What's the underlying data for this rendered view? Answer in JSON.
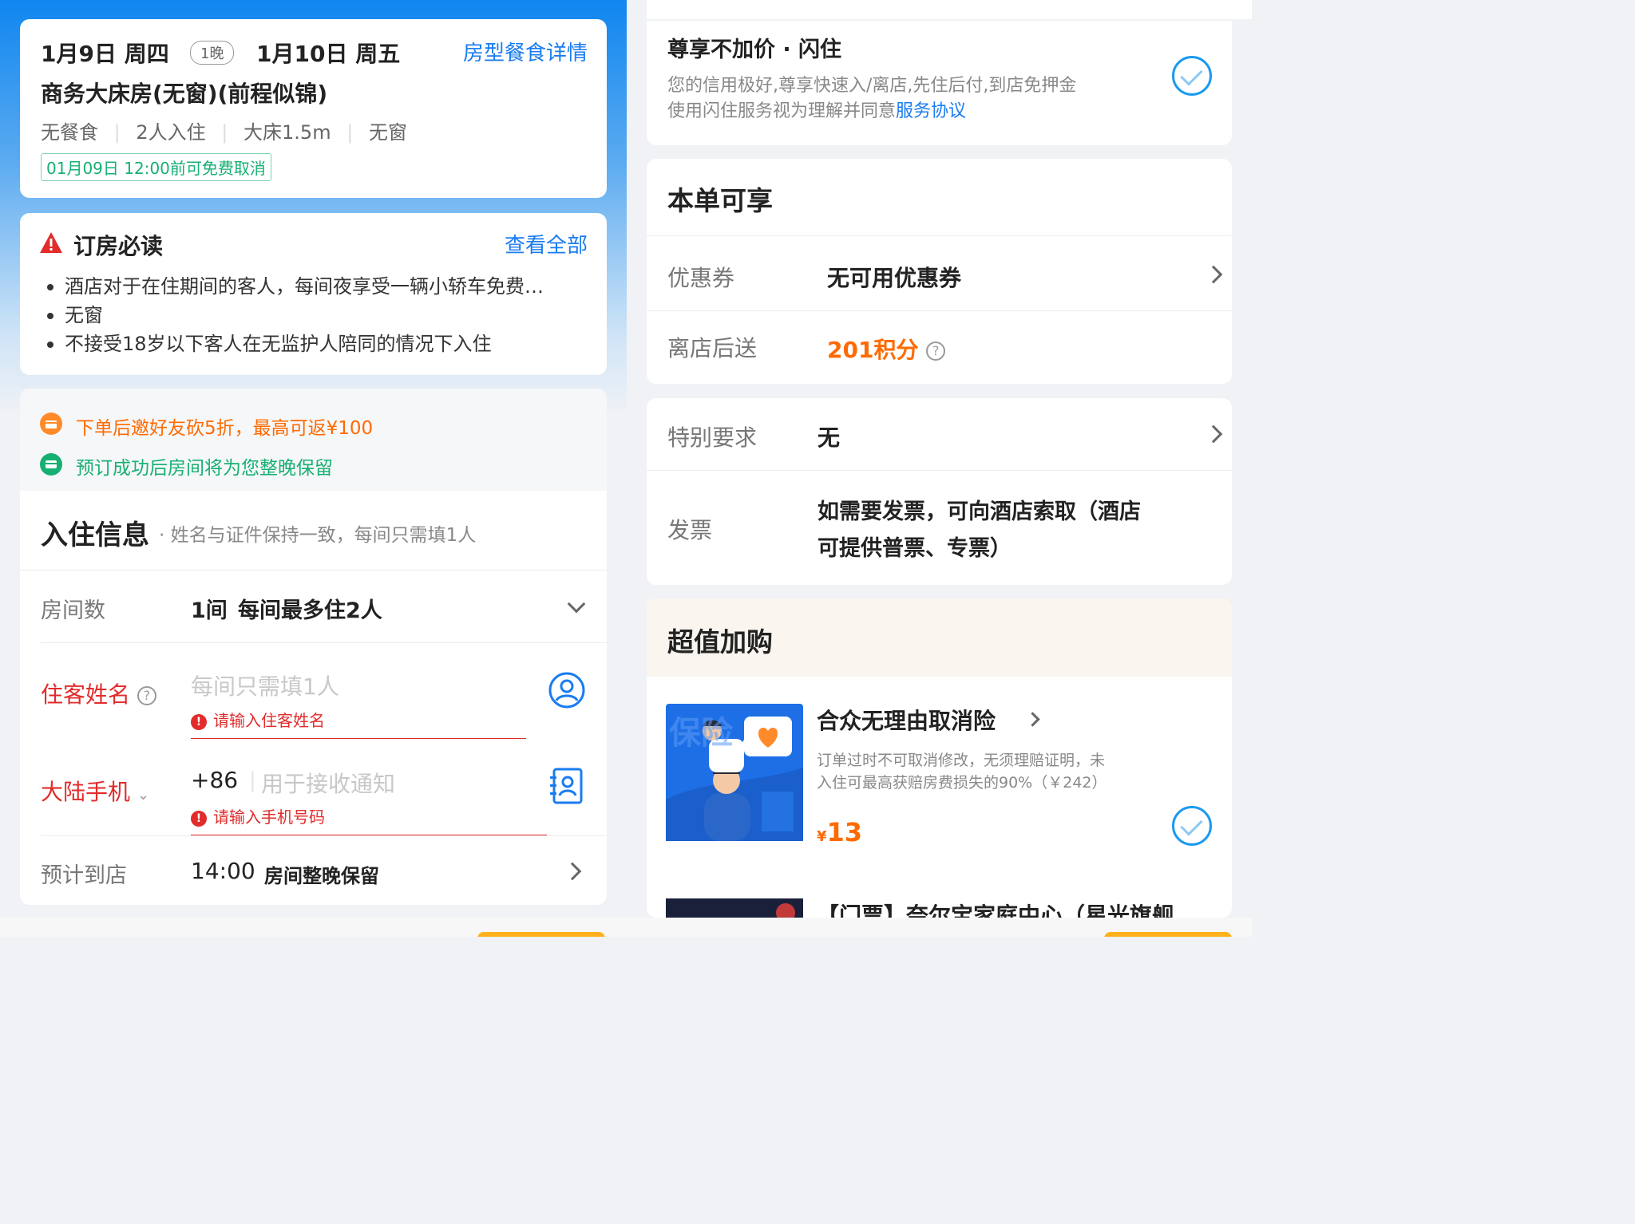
{
  "room_card": {
    "checkin": "1月9日 周四",
    "nights": "1晚",
    "checkout": "1月10日 周五",
    "detail_link": "房型餐食详情",
    "room_name": "商务大床房(无窗)(前程似锦)",
    "attrs": [
      "无餐食",
      "2人入住",
      "大床1.5m",
      "无窗"
    ],
    "cancel_policy": "01月09日 12:00前可免费取消"
  },
  "notice": {
    "title": "订房必读",
    "view_all": "查看全部",
    "items": [
      "酒店对于在住期间的客人，每间夜享受一辆小轿车免费…",
      "无窗",
      "不接受18岁以下客人在无监护人陪同的情况下入住"
    ]
  },
  "promos": {
    "invite": "下单后邀好友砍5折，最高可返¥100",
    "reserve": "预订成功后房间将为您整晚保留"
  },
  "guest_info": {
    "title": "入住信息",
    "subtitle": "· 姓名与证件保持一致，每间只需填1人",
    "rooms_label": "房间数",
    "rooms_value": "1间",
    "rooms_note": "每间最多住2人",
    "name_label": "住客姓名",
    "name_placeholder": "每间只需填1人",
    "name_error": "请输入住客姓名",
    "phone_label": "大陆手机",
    "phone_code": "+86",
    "phone_placeholder": "用于接收通知",
    "phone_error": "请输入手机号码",
    "arrival_label": "预计到店",
    "arrival_time": "14:00",
    "arrival_note": "房间整晚保留"
  },
  "flash_stay": {
    "title": "尊享不加价 · 闪住",
    "desc1": "您的信用极好,尊享快速入/离店,先住后付,到店免押金",
    "desc2_prefix": "使用闪住服务视为理解并同意",
    "desc2_link": "服务协议"
  },
  "benefits": {
    "title": "本单可享",
    "coupon_label": "优惠券",
    "coupon_value": "无可用优惠券",
    "points_label": "离店后送",
    "points_value": "201积分"
  },
  "requests": {
    "special_label": "特别要求",
    "special_value": "无",
    "invoice_label": "发票",
    "invoice_line1": "如需要发票，可向酒店索取（酒店",
    "invoice_line2": "可提供普票、专票）"
  },
  "addons": {
    "title": "超值加购",
    "image_text": "保险",
    "item_title": "合众无理由取消险",
    "item_desc1": "订单过时不可取消修改，无须理赔证明，未",
    "item_desc2": "入住可最高获赔房费损失的90%（￥242）",
    "currency": "¥",
    "price": "13",
    "next_item_title": "【门票】奈尔宝家庭中心（星光旗舰"
  },
  "colors": {
    "brand_blue": "#1a7cf0",
    "accent_orange": "#ff6a00",
    "success_green": "#16b072",
    "error_red": "#e22b2b"
  }
}
